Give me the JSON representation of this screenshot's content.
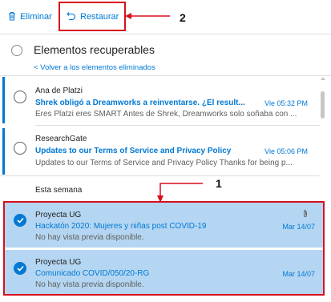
{
  "toolbar": {
    "delete_label": "Eliminar",
    "delete_icon": "trash-icon",
    "restore_label": "Restaurar",
    "restore_icon": "undo-icon"
  },
  "annotations": {
    "restore_marker": "2",
    "selection_marker": "1",
    "color": "#d80f1e"
  },
  "folder": {
    "title": "Elementos recuperables",
    "back_link": "< Volver a los elementos eliminados"
  },
  "messages": [
    {
      "sender": "Ana de Platzi",
      "subject": "Shrek obligó a Dreamworks a reinventarse. ¿El result...",
      "date": "Vie 05:32 PM",
      "preview": "Eres Platzi eres SMART Antes de Shrek, Dreamworks solo soñaba con ..."
    },
    {
      "sender": "ResearchGate",
      "subject": "Updates to our Terms of Service and Privacy Policy",
      "date": "Vie 05:06 PM",
      "preview": "Updates to our Terms of Service and Privacy Policy Thanks for being p..."
    }
  ],
  "section_label": "Esta semana",
  "selected_messages": [
    {
      "sender": "Proyecta UG",
      "subject": "Hackatón 2020: Mujeres y niñas post COVID-19",
      "date": "Mar 14/07",
      "preview": "No hay vista previa disponible.",
      "has_attachment": true
    },
    {
      "sender": "Proyecta UG",
      "subject": "Comunicado COVID/050/20-RG",
      "date": "Mar 14/07",
      "preview": "No hay vista previa disponible.",
      "has_attachment": false
    }
  ],
  "colors": {
    "accent": "#0078d4",
    "selected_bg": "#b4d6f2",
    "annotation": "#d80f1e"
  }
}
